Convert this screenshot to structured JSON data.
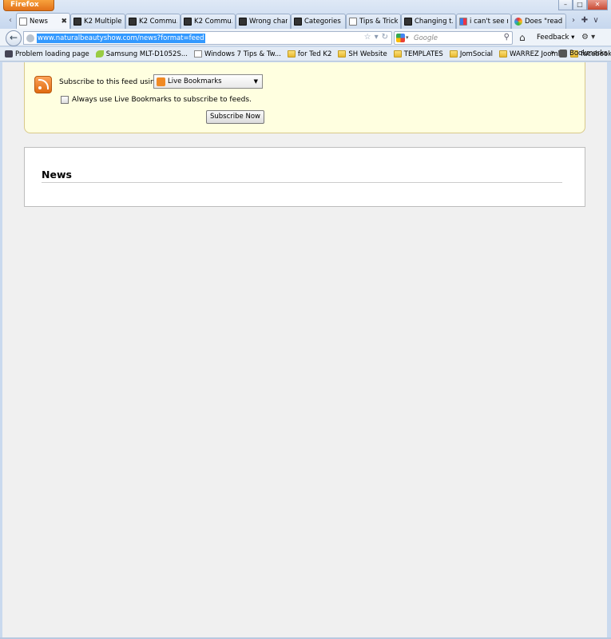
{
  "browser": {
    "app_button": "Firefox",
    "tabs": [
      {
        "label": "News",
        "icon": "page-icon",
        "active": true
      },
      {
        "label": "K2 Multiple ...",
        "icon": "k2-icon"
      },
      {
        "label": "K2 Commu...",
        "icon": "k2-icon"
      },
      {
        "label": "K2 Commu...",
        "icon": "k2-icon"
      },
      {
        "label": "Wrong char...",
        "icon": "k2-icon"
      },
      {
        "label": "Categories -...",
        "icon": "k2-icon"
      },
      {
        "label": "Tips & Trick...",
        "icon": "page-icon"
      },
      {
        "label": "Changing t...",
        "icon": "k2-icon"
      },
      {
        "label": "i can't see r...",
        "icon": "google-icon"
      },
      {
        "label": "Does \"read ...",
        "icon": "diamond-icon"
      }
    ],
    "url": "www.naturalbeautyshow.com/news?format=feed",
    "search_placeholder": "Google",
    "feedback_label": "Feedback",
    "bookmarks": [
      {
        "label": "Problem loading page",
        "icon": "bug-icon"
      },
      {
        "label": "Samsung MLT-D1052S...",
        "icon": "leaf-icon"
      },
      {
        "label": "Windows 7 Tips & Tw...",
        "icon": "page-icon"
      },
      {
        "label": "for Ted K2",
        "icon": "folder-icon"
      },
      {
        "label": "SH Website",
        "icon": "folder-icon"
      },
      {
        "label": "TEMPLATES",
        "icon": "folder-icon"
      },
      {
        "label": "JomSocial",
        "icon": "folder-icon"
      },
      {
        "label": "WARREZ Joomla",
        "icon": "folder-icon"
      },
      {
        "label": "facebook",
        "icon": "folder-icon"
      }
    ],
    "bookmarks_menu": "Bookmarks"
  },
  "feed": {
    "subscribe_label": "Subscribe to this feed using",
    "reader_selected": "Live Bookmarks",
    "always_use_label": "Always use Live Bookmarks to subscribe to feeds.",
    "always_use_checked": false,
    "subscribe_button": "Subscribe Now"
  },
  "news": {
    "title": "News"
  }
}
